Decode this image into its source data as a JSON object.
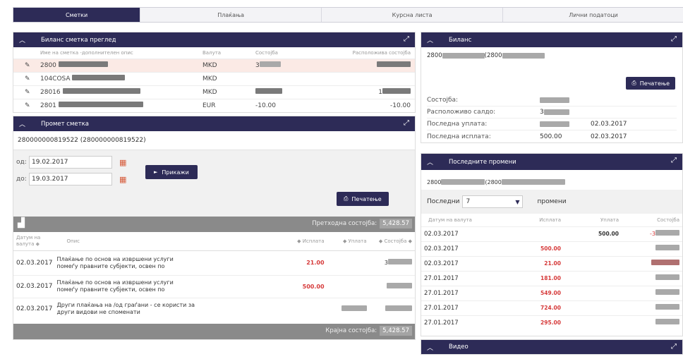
{
  "tabs": [
    "Сметки",
    "Плаќања",
    "Курсна листа",
    "Лични податоци"
  ],
  "balance_overview": {
    "title": "Биланс сметка преглед",
    "columns": [
      "Име на сметка -дополнителен опис",
      "Валута",
      "Состојба",
      "Расположива состојба"
    ],
    "rows": [
      {
        "name": "2800",
        "currency": "MKD",
        "state": "3",
        "available": ""
      },
      {
        "name": "104COSA",
        "currency": "MKD",
        "state": "",
        "available": ""
      },
      {
        "name": "28016",
        "currency": "MKD",
        "state": "",
        "available": "1"
      },
      {
        "name": "2801",
        "currency": "EUR",
        "state": "-10.00",
        "available": "-10.00"
      }
    ]
  },
  "turnover": {
    "title": "Промет сметка",
    "account": "280000000819522 (280000000819522)",
    "from_label": "од:",
    "from_date": "19.02.2017",
    "to_label": "до:",
    "to_date": "19.03.2017",
    "show_button": "Прикажи",
    "print_button": "Печатење",
    "previous_state_label": "Претходна состојба:",
    "previous_state_value": "5,428.57",
    "columns": [
      "Датум на валута",
      "Опис",
      "Исплата",
      "Уплата",
      "Состојба"
    ],
    "rows": [
      {
        "date": "02.03.2017",
        "desc1": "Плаќање по основ на извршени услуги",
        "desc2": "помеѓу правните субјекти, освен по",
        "payout": "21.00",
        "payin": "",
        "state": "3"
      },
      {
        "date": "02.03.2017",
        "desc1": "Плаќање по основ на извршени услуги",
        "desc2": "помеѓу правните субјекти, освен по",
        "payout": "500.00",
        "payin": "",
        "state": ""
      },
      {
        "date": "02.03.2017",
        "desc1": "Други плаќања на /од граѓани - се користи за",
        "desc2": "други видови не споменати",
        "payout": "",
        "payin": "",
        "state": ""
      }
    ],
    "final_state_label": "Крајна состојба:",
    "final_state_value": "5,428.57"
  },
  "balance": {
    "title": "Биланс",
    "account_a": "2800",
    "account_b": "(2800",
    "print_button": "Печатење",
    "state_label": "Состојба:",
    "available_label": "Расположиво салдо:",
    "available_value": "3",
    "last_payin_label": "Последна уплата:",
    "last_payin_date": "02.03.2017",
    "last_payout_label": "Последна исплата:",
    "last_payout_value": "500.00",
    "last_payout_date": "02.03.2017"
  },
  "recent_changes": {
    "title": "Последните промени",
    "account_a": "2800",
    "account_b": "(2800",
    "last_label": "Последни",
    "last_count": "7",
    "changes_label": "промени",
    "columns": [
      "Датум на валута",
      "Исплата",
      "Уплата",
      "Состојба"
    ],
    "rows": [
      {
        "date": "02.03.2017",
        "payout": "",
        "payin": "500.00",
        "state": "-3"
      },
      {
        "date": "02.03.2017",
        "payout": "500.00",
        "payin": "",
        "state": ""
      },
      {
        "date": "02.03.2017",
        "payout": "21.00",
        "payin": "",
        "state": ""
      },
      {
        "date": "27.01.2017",
        "payout": "181.00",
        "payin": "",
        "state": ""
      },
      {
        "date": "27.01.2017",
        "payout": "549.00",
        "payin": "",
        "state": ""
      },
      {
        "date": "27.01.2017",
        "payout": "724.00",
        "payin": "",
        "state": ""
      },
      {
        "date": "27.01.2017",
        "payout": "295.00",
        "payin": "",
        "state": ""
      }
    ]
  },
  "video": {
    "title": "Видео"
  },
  "colors": {
    "header": "#2d2b57",
    "accent_red": "#d63a3a",
    "edit_orange": "#e0733a"
  }
}
